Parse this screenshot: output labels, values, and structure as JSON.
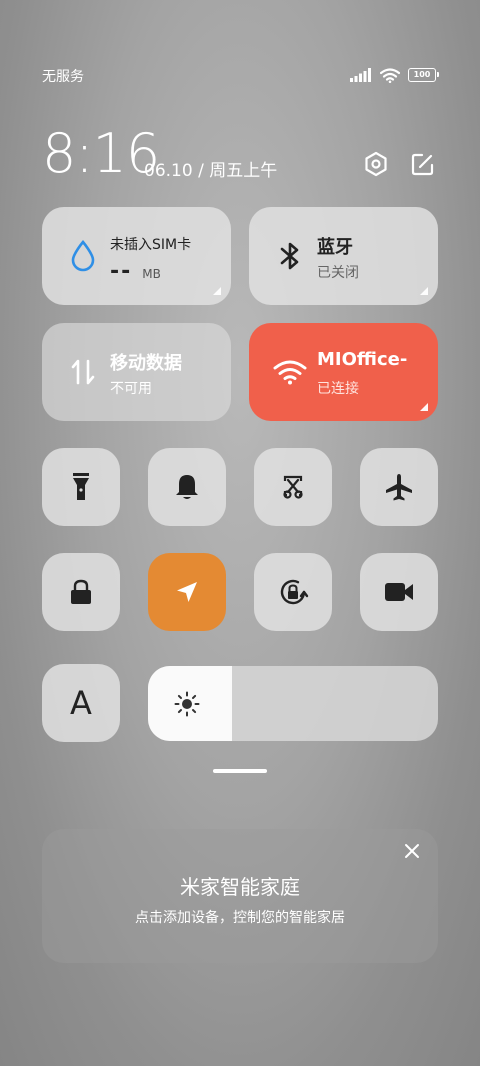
{
  "status_bar": {
    "carrier": "无服务",
    "battery": "100",
    "icons": [
      "signal-icon",
      "wifi-icon",
      "battery-icon"
    ]
  },
  "header": {
    "time": "8:16",
    "date": "06.10 / 周五上午",
    "buttons": [
      "settings-icon",
      "edit-icon"
    ]
  },
  "tiles": {
    "sim": {
      "label": "未插入SIM卡",
      "value": "--",
      "unit": "MB",
      "icon": "water-drop-icon"
    },
    "bluetooth": {
      "label": "蓝牙",
      "status": "已关闭",
      "icon": "bluetooth-icon"
    },
    "mobile_data": {
      "label": "移动数据",
      "status": "不可用",
      "icon": "data-arrows-icon"
    },
    "wifi": {
      "label": "MIOffice-",
      "status": "已连接",
      "icon": "wifi-icon"
    }
  },
  "toggles": [
    {
      "name": "flashlight",
      "icon": "flashlight-icon",
      "active": false
    },
    {
      "name": "notifications",
      "icon": "bell-icon",
      "active": false
    },
    {
      "name": "screenshot",
      "icon": "scissors-icon",
      "active": false
    },
    {
      "name": "airplane-mode",
      "icon": "airplane-icon",
      "active": false
    },
    {
      "name": "lock-screen",
      "icon": "lock-icon",
      "active": false
    },
    {
      "name": "location",
      "icon": "location-arrow-icon",
      "active": true
    },
    {
      "name": "auto-rotate",
      "icon": "rotation-lock-icon",
      "active": false
    },
    {
      "name": "screen-record",
      "icon": "video-camera-icon",
      "active": false
    }
  ],
  "font_tile": {
    "label": "A"
  },
  "brightness": {
    "level": 0.29,
    "icon": "sun-icon"
  },
  "mijia": {
    "title": "米家智能家庭",
    "subtitle": "点击添加设备，控制您的智能家居"
  },
  "colors": {
    "wifi_active": "#f0604b",
    "location_active": "#e48a33",
    "tile_bg": "#e1e1e1"
  }
}
